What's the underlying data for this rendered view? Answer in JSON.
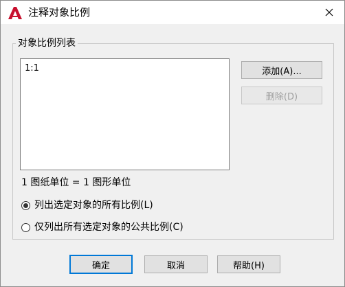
{
  "window": {
    "title": "注释对象比例",
    "close_glyph": "✕"
  },
  "group": {
    "legend": "对象比例列表",
    "list_items": [
      "1:1"
    ]
  },
  "buttons": {
    "add": "添加(A)...",
    "delete": "删除(D)",
    "ok": "确定",
    "cancel": "取消",
    "help": "帮助(H)"
  },
  "unit_text": "1 图纸单位 = 1 图形单位",
  "options": [
    {
      "label": "列出选定对象的所有比例(L)",
      "checked": true
    },
    {
      "label": "仅列出所有选定对象的公共比例(C)",
      "checked": false
    }
  ],
  "colors": {
    "logo_red": "#c8102e",
    "accent": "#0078d7"
  }
}
